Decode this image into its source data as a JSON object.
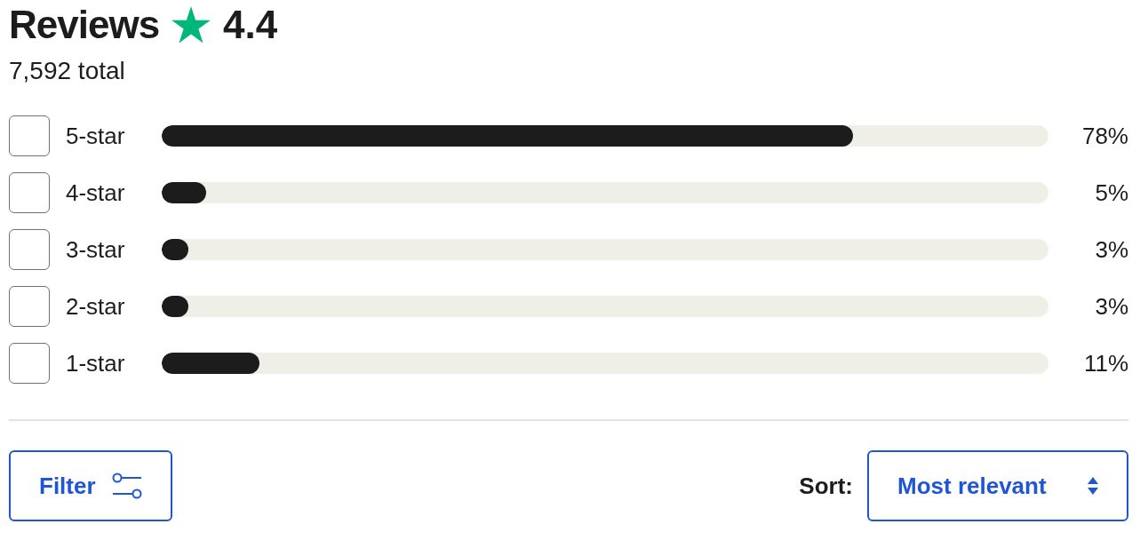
{
  "header": {
    "title": "Reviews",
    "rating": "4.4",
    "total": "7,592 total"
  },
  "rating_rows": [
    {
      "label": "5-star",
      "checked": false,
      "level": 0.78,
      "percent": "78%"
    },
    {
      "label": "4-star",
      "checked": false,
      "level": 0.05,
      "percent": "5%"
    },
    {
      "label": "3-star",
      "checked": false,
      "level": 0.03,
      "percent": "3%"
    },
    {
      "label": "2-star",
      "checked": false,
      "level": 0.03,
      "percent": "3%"
    },
    {
      "label": "1-star",
      "checked": false,
      "level": 0.11,
      "percent": "11%"
    }
  ],
  "filter_button": {
    "label": "Filter"
  },
  "sort": {
    "label": "Sort:",
    "value": "Most relevant"
  }
}
